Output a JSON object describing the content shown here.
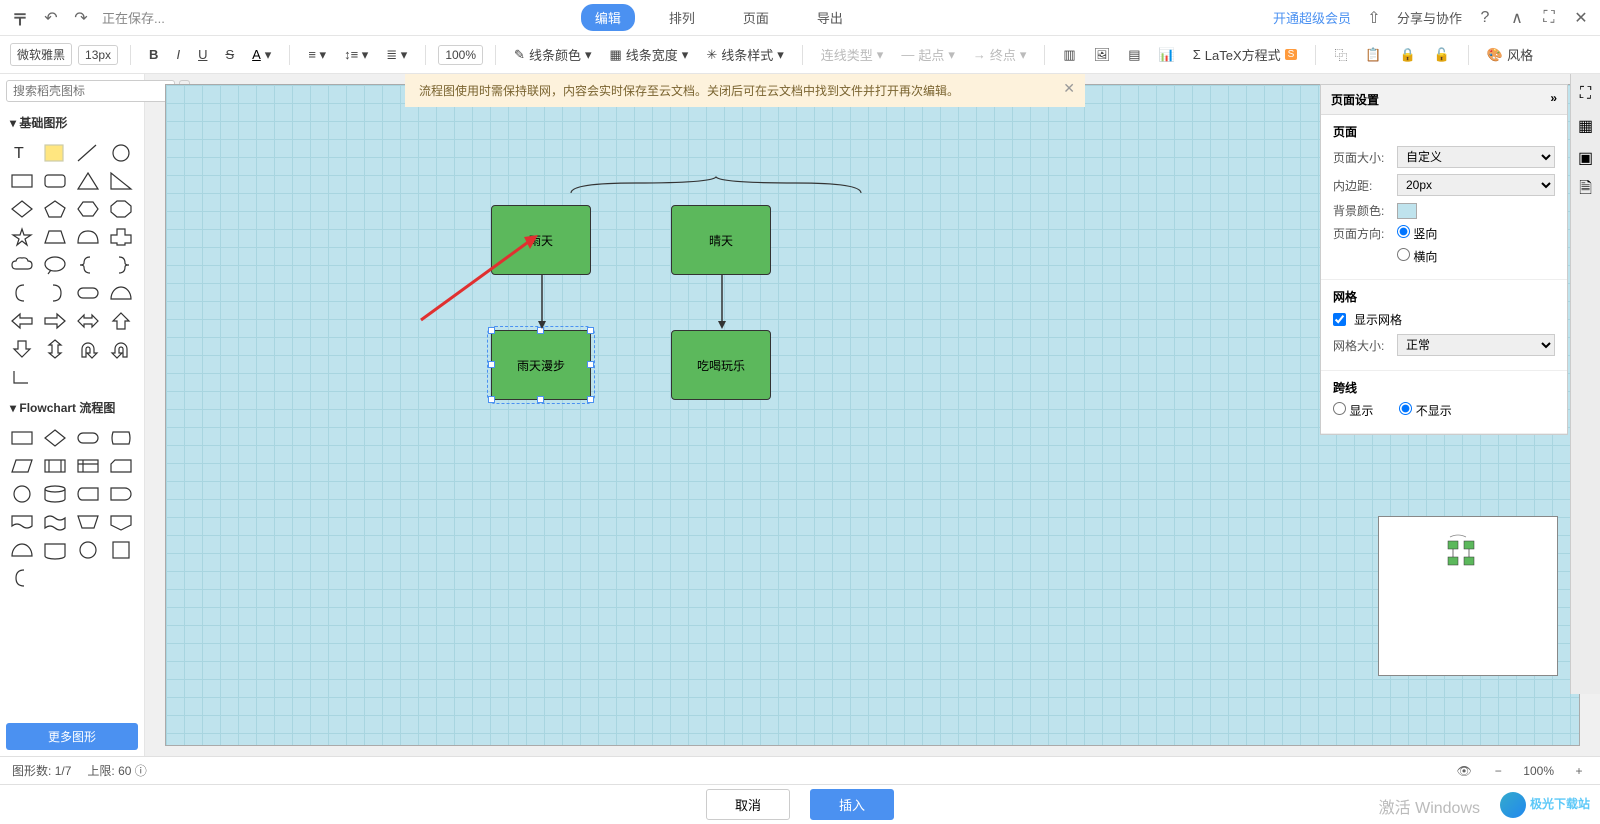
{
  "topbar": {
    "saving": "正在保存...",
    "tabs": {
      "edit": "编辑",
      "arrange": "排列",
      "page": "页面",
      "export": "导出"
    },
    "upgrade": "开通超级会员",
    "share": "分享与协作"
  },
  "toolbar": {
    "font": "微软雅黑",
    "font_size": "13px",
    "zoom": "100%",
    "line_color": "线条颜色",
    "line_width": "线条宽度",
    "line_style": "线条样式",
    "conn_type": "连线类型",
    "start_point": "起点",
    "end_point": "终点",
    "latex": "LaTeX方程式",
    "style_lib": "风格"
  },
  "search": {
    "placeholder": "搜索稻壳图标"
  },
  "sections": {
    "basic": "基础图形",
    "flowchart": "Flowchart 流程图",
    "more": "更多图形"
  },
  "banner": "流程图使用时需保持联网，内容会实时保存至云文档。关闭后可在云文档中找到文件并打开再次编辑。",
  "nodes": {
    "a": "雨天",
    "b": "晴天",
    "c": "雨天漫步",
    "d": "吃喝玩乐"
  },
  "rightpanel": {
    "title": "页面设置",
    "page_section": "页面",
    "page_size_label": "页面大小:",
    "page_size_value": "自定义",
    "padding_label": "内边距:",
    "padding_value": "20px",
    "bg_label": "背景颜色:",
    "orient_label": "页面方向:",
    "orient_v": "竖向",
    "orient_h": "横向",
    "grid_section": "网格",
    "show_grid": "显示网格",
    "grid_size_label": "网格大小:",
    "grid_size_value": "正常",
    "cross_section": "跨线",
    "cross_show": "显示",
    "cross_hide": "不显示"
  },
  "status": {
    "shape_count_label": "图形数:",
    "shape_count": "1/7",
    "limit_label": "上限:",
    "limit": "60",
    "zoom": "100%"
  },
  "buttons": {
    "cancel": "取消",
    "insert": "插入"
  },
  "activate": "激活 Windows",
  "watermark": "极光下载站"
}
